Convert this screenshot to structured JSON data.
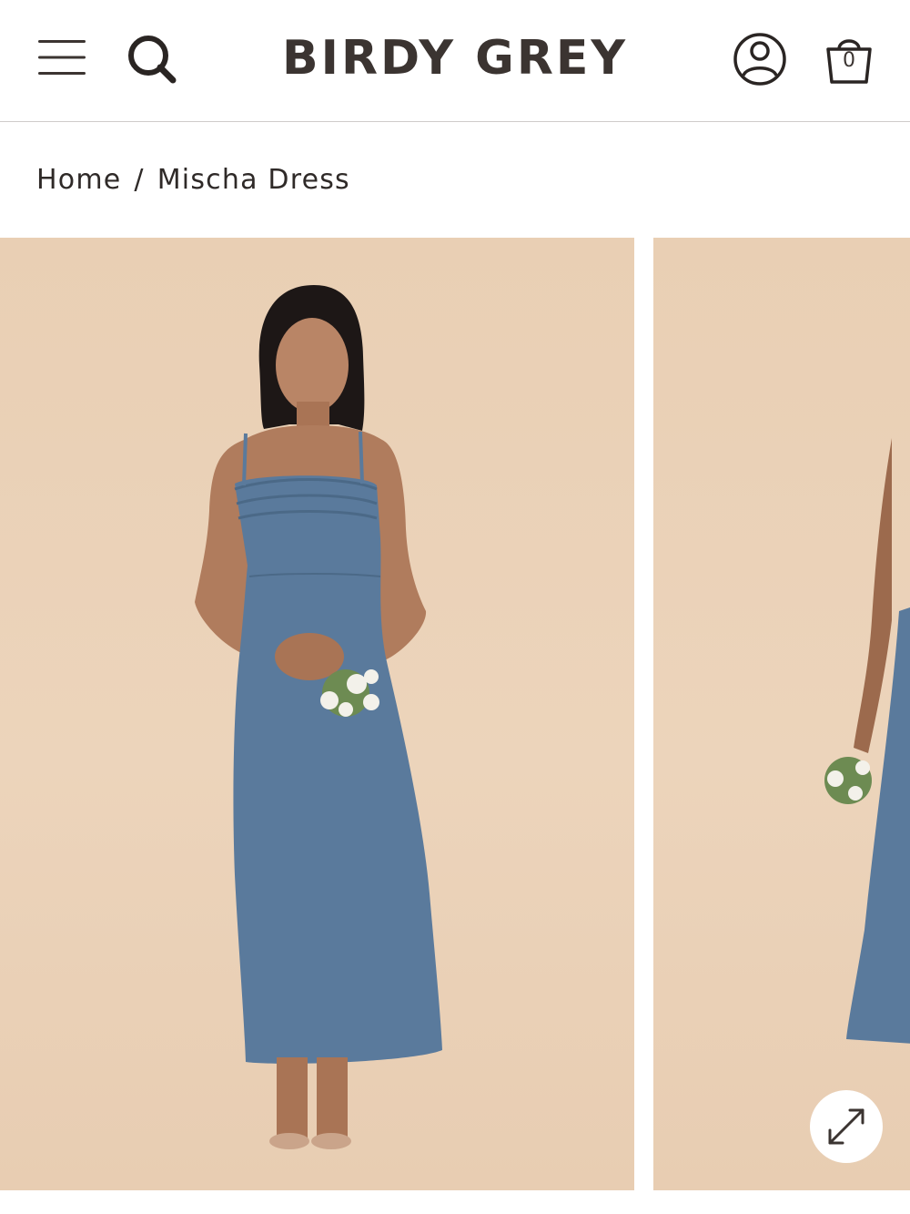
{
  "header": {
    "brand": "BIRDY GREY",
    "menu_icon": "hamburger-menu-icon",
    "search_icon": "search-icon",
    "account_icon": "user-account-icon",
    "bag_icon": "shopping-bag-icon",
    "bag_count": "0"
  },
  "breadcrumb": {
    "items": [
      {
        "label": "Home"
      },
      {
        "label": "Mischa Dress"
      }
    ],
    "separator": "/"
  },
  "gallery": {
    "expand_icon": "expand-arrows-icon",
    "slide_count_visible": 2
  },
  "colors": {
    "brand_text": "#3b3431",
    "photo_background": "#ebd1b7",
    "dress": "#5a7a9c",
    "divider": "#cfcccb"
  }
}
